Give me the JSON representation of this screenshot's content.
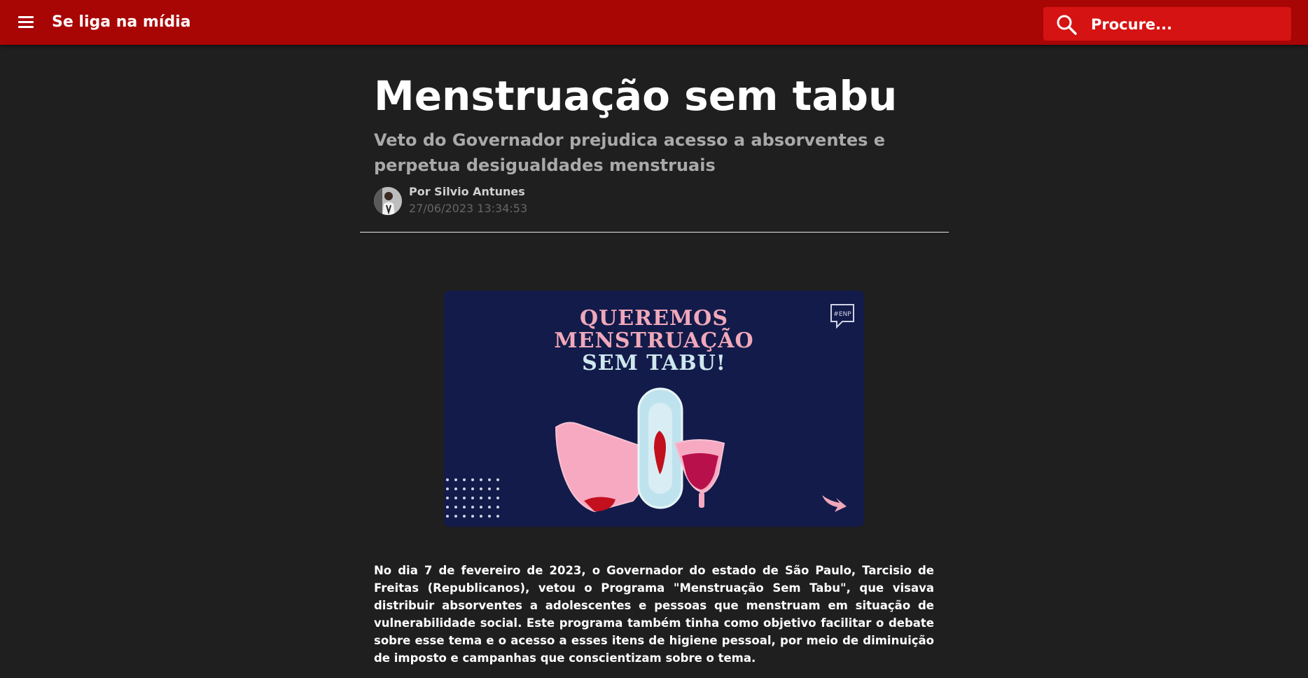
{
  "header": {
    "brand": "Se liga na mídia",
    "search_placeholder": "Procure..."
  },
  "article": {
    "title": "Menstruação sem tabu",
    "subtitle": "Veto do Governador prejudica acesso a absorventes e perpetua desigualdades menstruais",
    "byline": "Por Silvio Antunes",
    "date": "27/06/2023 13:34:53",
    "hero_image": {
      "line1": "QUEREMOS",
      "line2": "MENSTRUAÇÃO",
      "line3": "SEM TABU!",
      "tag": "#ENP",
      "colors": {
        "background": "#131b4a",
        "headline": "#f0a8ba",
        "accent": "#cfe8ee"
      }
    },
    "paragraph1": "No dia 7 de fevereiro de 2023, o Governador do estado de São Paulo, Tarcisio de Freitas (Republicanos), vetou o Programa \"Menstruação Sem Tabu\", que visava distribuir absorventes a adolescentes e pessoas que menstruam em situação de vulnerabilidade social. Este programa também tinha como objetivo facilitar o debate sobre esse tema e o acesso a esses itens de higiene pessoal, por meio de diminuição de imposto e campanhas que conscientizam sobre o tema."
  },
  "colors": {
    "topbar": "#a80505",
    "search": "#d51313",
    "page_bg": "#1f1f1f"
  }
}
